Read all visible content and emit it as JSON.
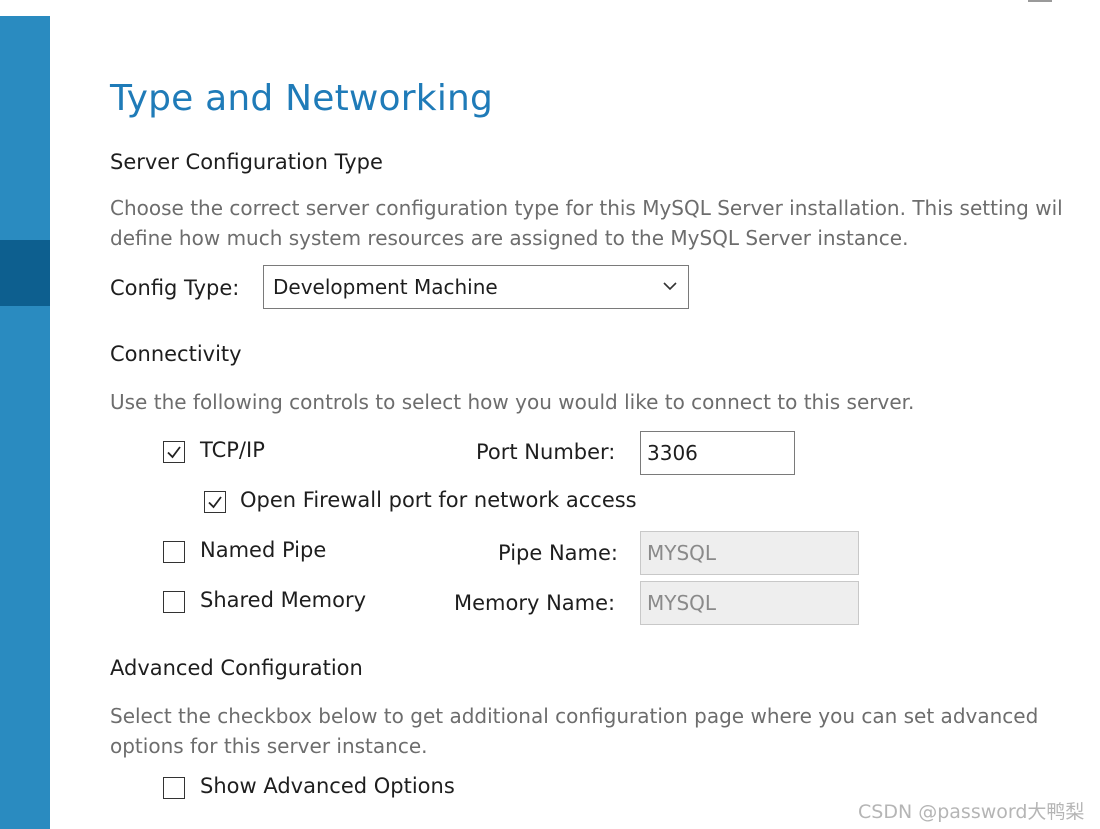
{
  "page": {
    "title": "Type and Networking"
  },
  "server_config": {
    "heading": "Server Configuration Type",
    "description_line1": "Choose the correct server configuration type for this MySQL Server installation. This setting wil",
    "description_line2": "define how much system resources are assigned to the MySQL Server instance.",
    "config_type_label": "Config Type:",
    "config_type_value": "Development Machine"
  },
  "connectivity": {
    "heading": "Connectivity",
    "description": "Use the following controls to select how you would like to connect to this server.",
    "tcpip": {
      "label": "TCP/IP",
      "checked": true
    },
    "port_label": "Port Number:",
    "port_value": "3306",
    "firewall": {
      "label": "Open Firewall port for network access",
      "checked": true
    },
    "named_pipe": {
      "label": "Named Pipe",
      "checked": false
    },
    "pipe_name_label": "Pipe Name:",
    "pipe_name_value": "MYSQL",
    "shared_memory": {
      "label": "Shared Memory",
      "checked": false
    },
    "memory_name_label": "Memory Name:",
    "memory_name_value": "MYSQL"
  },
  "advanced": {
    "heading": "Advanced Configuration",
    "description_line1": "Select the checkbox below to get additional configuration page where you can set advanced",
    "description_line2": "options for this server instance.",
    "show_advanced": {
      "label": "Show Advanced Options",
      "checked": false
    }
  },
  "watermark": "CSDN @password大鸭梨",
  "colors": {
    "sidebar": "#2a8bc0",
    "sidebar_active": "#0d5f8f",
    "title": "#1f7bb8"
  }
}
